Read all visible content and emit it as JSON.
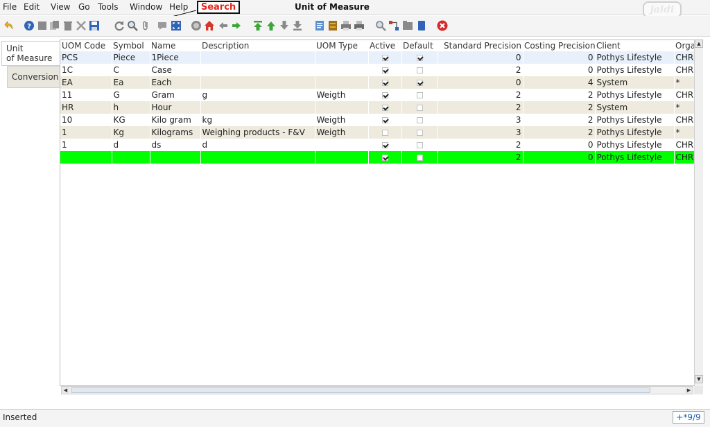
{
  "menu": {
    "file": "File",
    "edit": "Edit",
    "view": "View",
    "go": "Go",
    "tools": "Tools",
    "window": "Window",
    "help": "Help"
  },
  "window_title": "Unit of Measure",
  "callout": {
    "label": "Search"
  },
  "brand": {
    "logo_text": "jaldi"
  },
  "toolbar": {
    "icons": [
      "undo-icon",
      "help-icon",
      "new-record-icon",
      "copy-record-icon",
      "delete-icon",
      "delete-selection-icon",
      "save-icon",
      "refresh-icon",
      "find-icon",
      "attachment-icon",
      "chat-icon",
      "grid-toggle-icon",
      "history-icon",
      "home-icon",
      "back-icon",
      "forward-icon",
      "first-record-icon",
      "previous-record-icon",
      "next-record-icon",
      "last-record-icon",
      "report-icon",
      "archive-icon",
      "print-preview-icon",
      "print-icon",
      "zoom-across-icon",
      "active-workflow-icon",
      "request-icon",
      "product-info-icon",
      "close-window-icon"
    ]
  },
  "tabs": [
    {
      "line1": "Unit",
      "line2": "of Measure"
    },
    {
      "line1": "Conversion"
    }
  ],
  "grid": {
    "columns": [
      "UOM Code",
      "Symbol",
      "Name",
      "Description",
      "UOM Type",
      "Active",
      "Default",
      "Standard Precision",
      "Costing Precision",
      "Client",
      "Orga"
    ],
    "rows": [
      {
        "code": "PCS",
        "symbol": "Piece",
        "name": "1Piece",
        "description": "",
        "uom_type": "",
        "active": true,
        "default": true,
        "std_precision": "0",
        "cost_precision": "0",
        "client": "Pothys Lifestyle",
        "org": "CHR"
      },
      {
        "code": "1C",
        "symbol": "C",
        "name": "Case",
        "description": "",
        "uom_type": "",
        "active": true,
        "default": false,
        "std_precision": "2",
        "cost_precision": "0",
        "client": "Pothys Lifestyle",
        "org": "CHR"
      },
      {
        "code": "EA",
        "symbol": "Ea",
        "name": "Each",
        "description": "",
        "uom_type": "",
        "active": true,
        "default": true,
        "std_precision": "0",
        "cost_precision": "4",
        "client": "System",
        "org": "*"
      },
      {
        "code": "11",
        "symbol": "G",
        "name": "Gram",
        "description": "g",
        "uom_type": "Weigth",
        "active": true,
        "default": false,
        "std_precision": "2",
        "cost_precision": "2",
        "client": "Pothys Lifestyle",
        "org": "CHR"
      },
      {
        "code": "HR",
        "symbol": "h",
        "name": "Hour",
        "description": "",
        "uom_type": "",
        "active": true,
        "default": false,
        "std_precision": "2",
        "cost_precision": "2",
        "client": "System",
        "org": "*"
      },
      {
        "code": "10",
        "symbol": "KG",
        "name": "Kilo gram",
        "description": "kg",
        "uom_type": "Weigth",
        "active": true,
        "default": false,
        "std_precision": "3",
        "cost_precision": "2",
        "client": "Pothys Lifestyle",
        "org": "CHR"
      },
      {
        "code": "1",
        "symbol": "Kg",
        "name": "Kilograms",
        "description": "Weighing products - F&V",
        "uom_type": "Weigth",
        "active": false,
        "default": false,
        "std_precision": "3",
        "cost_precision": "2",
        "client": "Pothys Lifestyle",
        "org": "*"
      },
      {
        "code": "1",
        "symbol": "d",
        "name": "ds",
        "description": "d",
        "uom_type": "",
        "active": true,
        "default": false,
        "std_precision": "2",
        "cost_precision": "0",
        "client": "Pothys Lifestyle",
        "org": "CHR"
      },
      {
        "code": "",
        "symbol": "",
        "name": "",
        "description": "",
        "uom_type": "",
        "active": true,
        "default": false,
        "std_precision": "2",
        "cost_precision": "0",
        "client": "Pothys Lifestyle",
        "org": "CHR"
      }
    ]
  },
  "status": {
    "text": "Inserted",
    "record_info": "+*9/9"
  },
  "colors": {
    "selected_row": "#00ff00",
    "alt_row": "#eeeadd",
    "first_row": "#e8f1fb",
    "callout_text": "#e3261c"
  }
}
